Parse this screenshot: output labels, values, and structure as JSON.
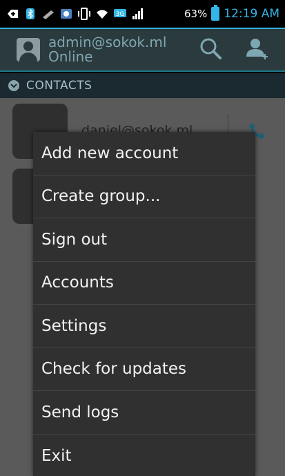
{
  "status_bar": {
    "battery_percent": "63%",
    "time": "12:19 AM",
    "network_badge": "3G",
    "icons": [
      "add-icon",
      "bluetooth-icon",
      "pen-icon",
      "vpn-icon",
      "vibrate-icon",
      "wifi-icon",
      "network-type-icon",
      "signal-icon",
      "battery-icon"
    ]
  },
  "header": {
    "account": "admin@sokok.ml",
    "status": "Online",
    "actions": [
      "search-icon",
      "add-contact-icon"
    ]
  },
  "section": {
    "label": "CONTACTS"
  },
  "contacts": [
    {
      "name": "daniel@sokok.ml"
    }
  ],
  "menu": {
    "items": [
      {
        "label": "Add new account"
      },
      {
        "label": "Create group..."
      },
      {
        "label": "Sign out"
      },
      {
        "label": "Accounts"
      },
      {
        "label": "Settings"
      },
      {
        "label": "Check for updates"
      },
      {
        "label": "Send logs"
      },
      {
        "label": "Exit"
      }
    ]
  },
  "colors": {
    "accent": "#33b5e5",
    "header_bg": "#2b3a3d",
    "menu_bg": "#303030"
  }
}
